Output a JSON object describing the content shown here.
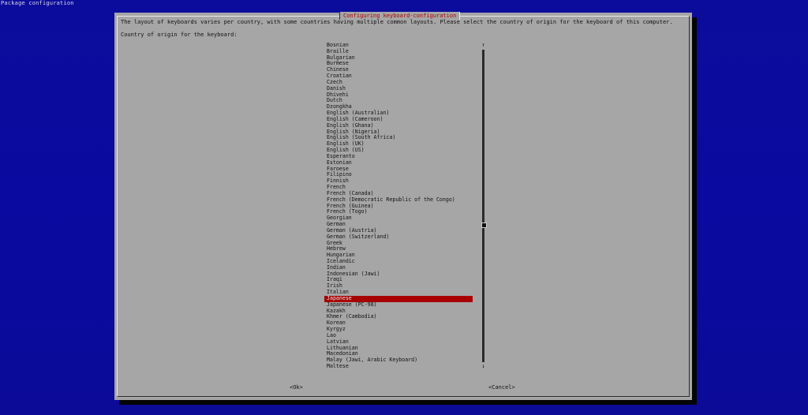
{
  "window": {
    "title": "Package configuration"
  },
  "dialog": {
    "title": "Configuring keyboard-configuration",
    "description": "The layout of keyboards varies per country, with some countries having multiple common layouts. Please select the country of origin for the keyboard of this computer.",
    "prompt": "Country of origin for the keyboard:",
    "selected_item": "Japanese",
    "items": [
      "Bosnian",
      "Braille",
      "Bulgarian",
      "Burmese",
      "Chinese",
      "Croatian",
      "Czech",
      "Danish",
      "Dhivehi",
      "Dutch",
      "Dzongkha",
      "English (Australian)",
      "English (Cameroon)",
      "English (Ghana)",
      "English (Nigeria)",
      "English (South Africa)",
      "English (UK)",
      "English (US)",
      "Esperanto",
      "Estonian",
      "Faroese",
      "Filipino",
      "Finnish",
      "French",
      "French (Canada)",
      "French (Democratic Republic of the Congo)",
      "French (Guinea)",
      "French (Togo)",
      "Georgian",
      "German",
      "German (Austria)",
      "German (Switzerland)",
      "Greek",
      "Hebrew",
      "Hungarian",
      "Icelandic",
      "Indian",
      "Indonesian (Jawi)",
      "Iraqi",
      "Irish",
      "Italian",
      "Japanese",
      "Japanese (PC-98)",
      "Kazakh",
      "Khmer (Cambodia)",
      "Korean",
      "Kyrgyz",
      "Lao",
      "Latvian",
      "Lithuanian",
      "Macedonian",
      "Malay (Jawi, Arabic Keyboard)",
      "Maltese"
    ],
    "scrollbar": {
      "up_arrow": "↑",
      "down_arrow": "↓"
    },
    "buttons": {
      "ok": "<Ok>",
      "cancel": "<Cancel>"
    }
  },
  "colors": {
    "background": "#0c0c9c",
    "dialog": "#a6a6a6",
    "title_text": "#b30000",
    "selection": "#a80000"
  }
}
